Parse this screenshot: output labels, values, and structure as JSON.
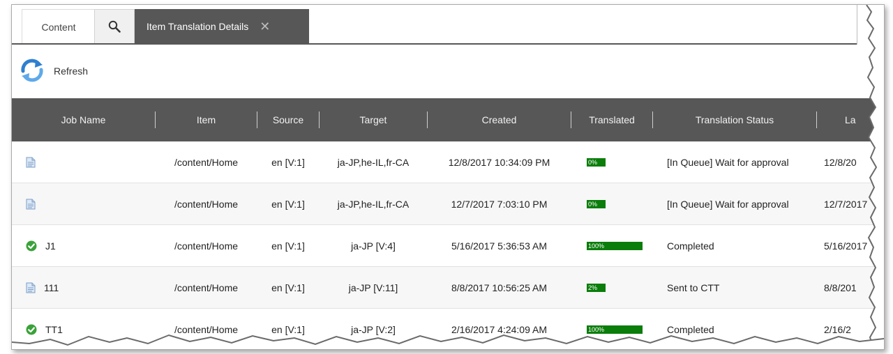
{
  "tabs": {
    "content_label": "Content",
    "active_label": "Item Translation Details",
    "close_glyph": "✕"
  },
  "toolbar": {
    "refresh_label": "Refresh"
  },
  "table": {
    "columns": [
      "Job Name",
      "Item",
      "Source",
      "Target",
      "Created",
      "Translated",
      "Translation Status",
      "La"
    ],
    "rows": [
      {
        "icon": "document-icon",
        "job": "",
        "item": "/content/Home",
        "source": "en [V:1]",
        "target": "ja-JP,he-IL,fr-CA",
        "created": "12/8/2017 10:34:09 PM",
        "translated_pct": 0,
        "translated_label": "0%",
        "status": "[In Queue] Wait for approval",
        "last": "12/8/20"
      },
      {
        "icon": "document-icon",
        "job": "",
        "item": "/content/Home",
        "source": "en [V:1]",
        "target": "ja-JP,he-IL,fr-CA",
        "created": "12/7/2017 7:03:10 PM",
        "translated_pct": 0,
        "translated_label": "0%",
        "status": "[In Queue] Wait for approval",
        "last": "12/7/2017"
      },
      {
        "icon": "check-circle-icon",
        "job": "J1",
        "item": "/content/Home",
        "source": "en [V:1]",
        "target": "ja-JP [V:4]",
        "created": "5/16/2017 5:36:53 AM",
        "translated_pct": 100,
        "translated_label": "100%",
        "status": "Completed",
        "last": "5/16/2017"
      },
      {
        "icon": "document-icon",
        "job": "111",
        "item": "/content/Home",
        "source": "en [V:1]",
        "target": "ja-JP [V:11]",
        "created": "8/8/2017 10:56:25 AM",
        "translated_pct": 2,
        "translated_label": "2%",
        "status": "Sent to CTT",
        "last": "8/8/201"
      },
      {
        "icon": "check-circle-icon",
        "job": "TT1",
        "item": "/content/Home",
        "source": "en [V:1]",
        "target": "ja-JP [V:2]",
        "created": "2/16/2017 4:24:09 AM",
        "translated_pct": 100,
        "translated_label": "100%",
        "status": "Completed",
        "last": "2/16/2"
      }
    ]
  },
  "colors": {
    "header_bg": "#575757",
    "progress_green": "#0a7d0a",
    "check_green": "#3aa23a",
    "refresh_blue": "#2f7fd0"
  }
}
